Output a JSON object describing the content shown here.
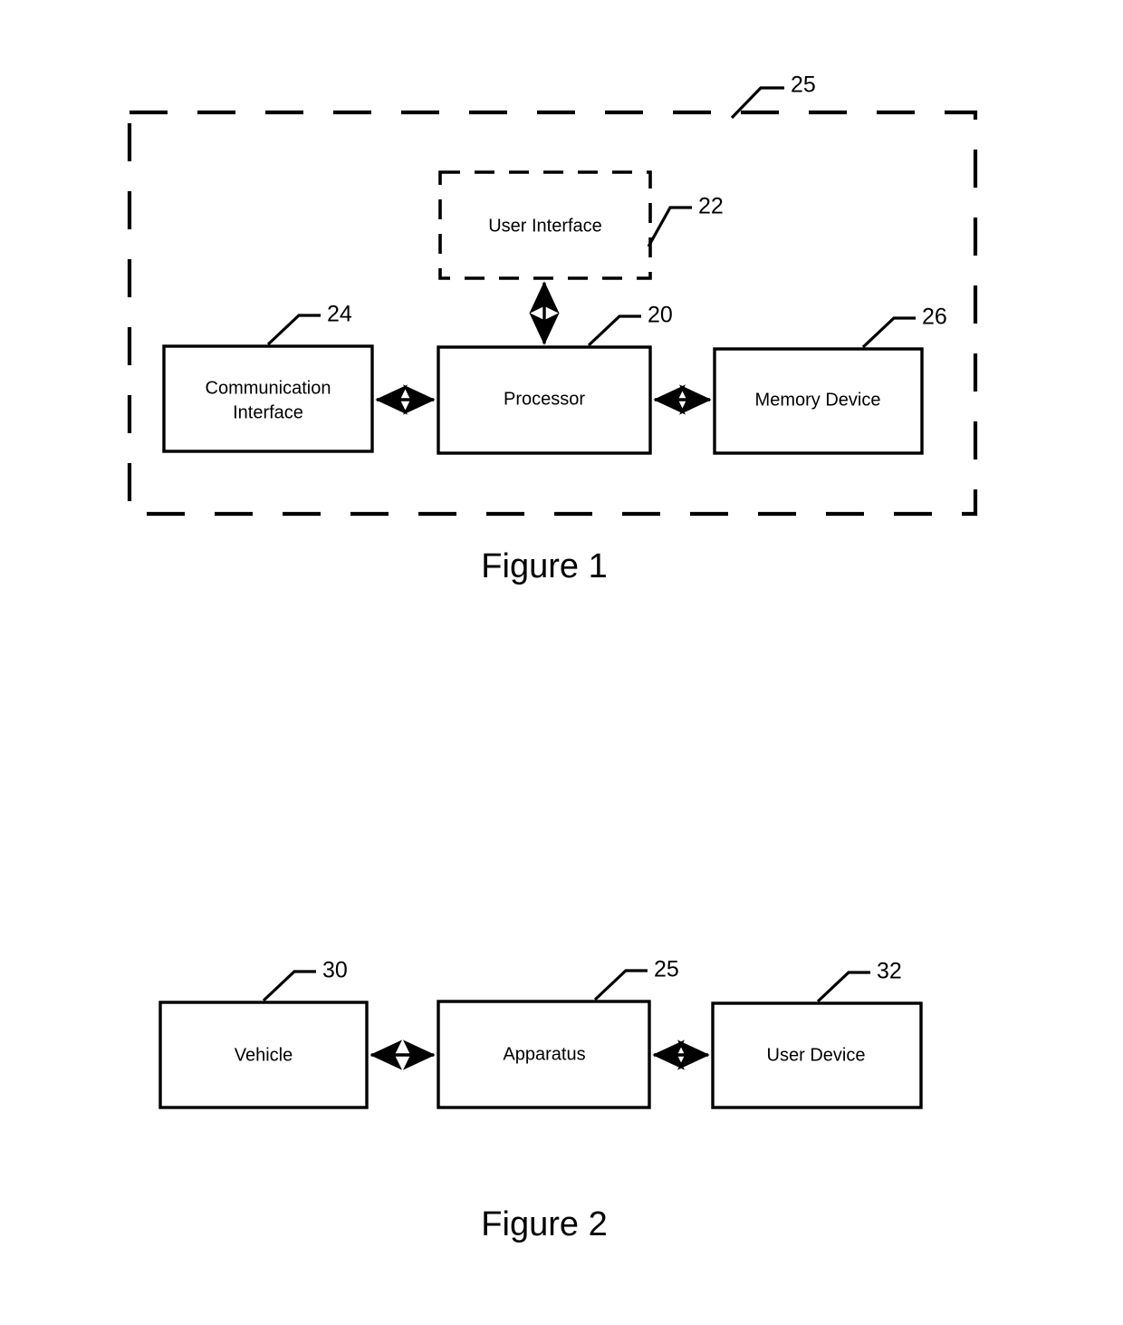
{
  "document": {
    "type": "patent-drawing-sheet",
    "figures": [
      {
        "id": "figure-1",
        "caption": "Figure 1",
        "container": {
          "label_ref": "25",
          "style": "dashed"
        },
        "blocks": [
          {
            "id": "user-interface",
            "label": "User Interface",
            "ref": "22",
            "style": "dashed"
          },
          {
            "id": "communication-interface",
            "label": "Communication Interface",
            "label_line_1": "Communication",
            "label_line_2": "Interface",
            "ref": "24",
            "style": "solid"
          },
          {
            "id": "processor",
            "label": "Processor",
            "ref": "20",
            "style": "solid"
          },
          {
            "id": "memory-device",
            "label": "Memory Device",
            "ref": "26",
            "style": "solid"
          }
        ],
        "connections": [
          {
            "from": "user-interface",
            "to": "processor",
            "arrows": "both",
            "orientation": "vertical"
          },
          {
            "from": "communication-interface",
            "to": "processor",
            "arrows": "both",
            "orientation": "horizontal"
          },
          {
            "from": "processor",
            "to": "memory-device",
            "arrows": "both",
            "orientation": "horizontal"
          }
        ]
      },
      {
        "id": "figure-2",
        "caption": "Figure 2",
        "blocks": [
          {
            "id": "vehicle",
            "label": "Vehicle",
            "ref": "30",
            "style": "solid"
          },
          {
            "id": "apparatus",
            "label": "Apparatus",
            "ref": "25",
            "style": "solid"
          },
          {
            "id": "user-device",
            "label": "User Device",
            "ref": "32",
            "style": "solid"
          }
        ],
        "connections": [
          {
            "from": "vehicle",
            "to": "apparatus",
            "arrows": "both",
            "orientation": "horizontal"
          },
          {
            "from": "apparatus",
            "to": "user-device",
            "arrows": "both",
            "orientation": "horizontal"
          }
        ]
      }
    ]
  },
  "colors": {
    "ink": "#000000",
    "paper": "#ffffff"
  }
}
